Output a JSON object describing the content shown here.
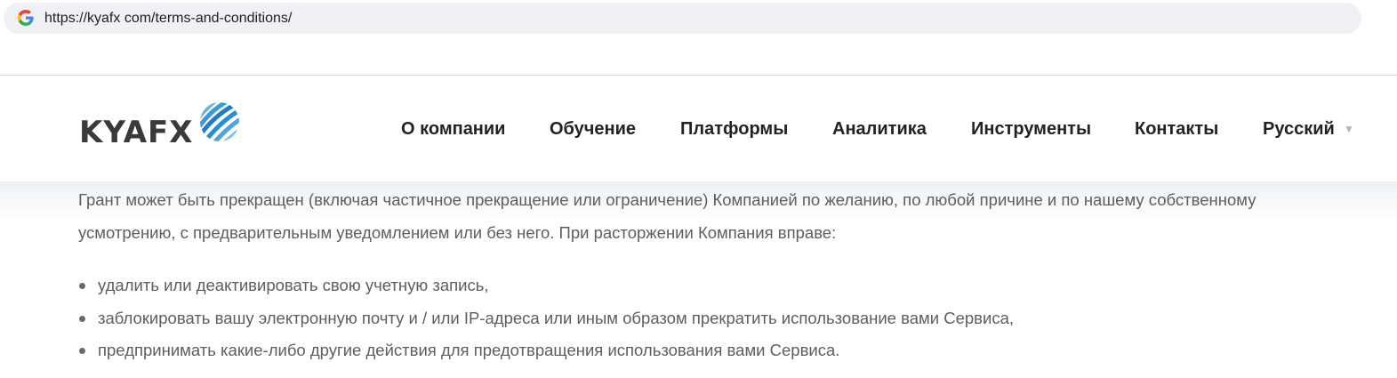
{
  "browser": {
    "url": "https://kyafx com/terms-and-conditions/",
    "site_icon": "google-g-icon"
  },
  "header": {
    "logo_text": "KYAFX",
    "nav": [
      {
        "label": "О компании"
      },
      {
        "label": "Обучение"
      },
      {
        "label": "Платформы"
      },
      {
        "label": "Аналитика"
      },
      {
        "label": "Инструменты"
      },
      {
        "label": "Контакты"
      },
      {
        "label": "Русский",
        "icon": "dropdown-triangle-icon"
      }
    ]
  },
  "content": {
    "paragraph_line1": "Грант может быть прекращен (включая частичное прекращение или ограничение) Компанией по желанию, по любой причине и по нашему собственному",
    "paragraph_line2": "усмотрению, с предварительным уведомлением или без него. При расторжении Компания вправе:",
    "bullets": [
      "удалить или деактивировать свою учетную запись,",
      "заблокировать вашу электронную почту и / или IP-адреса или иным образом прекратить использование вами Сервиса,",
      "предпринимать какие-либо другие действия для предотвращения использования вами Сервиса."
    ]
  },
  "colors": {
    "logo_text": "#3a3a3a",
    "logo_globe": "#2a8fd0",
    "nav_text": "#222222",
    "body_text": "#5e5e5e",
    "omnibox_bg": "#eff1f4"
  }
}
